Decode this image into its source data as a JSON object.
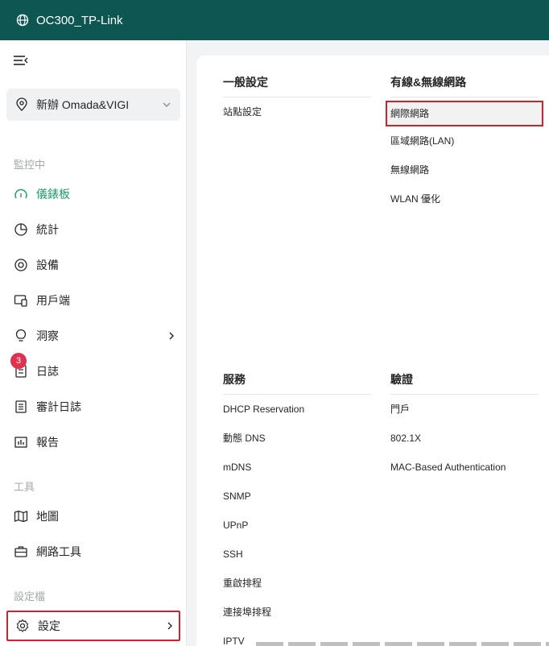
{
  "header": {
    "title": "OC300_TP-Link",
    "icon": "globe-icon"
  },
  "sidebar": {
    "site_selector": {
      "label": "新辦 Omada&VIGI"
    },
    "sections": {
      "monitor": "監控中",
      "tools": "工具",
      "profile": "設定檔"
    },
    "items": {
      "dashboard": "儀錶板",
      "statistics": "統計",
      "devices": "設備",
      "clients": "用戶端",
      "insight": "洞察",
      "logs": "日誌",
      "audit_logs": "審計日誌",
      "reports": "報告",
      "map": "地圖",
      "network_tools": "網路工具",
      "settings": "設定"
    },
    "log_badge": "3"
  },
  "panel": {
    "general": {
      "title": "一般設定",
      "items": [
        "站點設定"
      ]
    },
    "wired_wireless": {
      "title": "有線&無線網路",
      "items": [
        "網際網路",
        "區域網路(LAN)",
        "無線網路",
        "WLAN 優化"
      ]
    },
    "services": {
      "title": "服務",
      "items": [
        "DHCP Reservation",
        "動態 DNS",
        "mDNS",
        "SNMP",
        "UPnP",
        "SSH",
        "重啟排程",
        "連接埠排程",
        "IPTV"
      ]
    },
    "auth": {
      "title": "驗證",
      "items": [
        "門戶",
        "802.1X",
        "MAC-Based Authentication"
      ]
    }
  },
  "colors": {
    "header": "#0e5652",
    "active": "#1d9b6e",
    "highlight": "#d3202f",
    "badge": "#e0314e"
  }
}
